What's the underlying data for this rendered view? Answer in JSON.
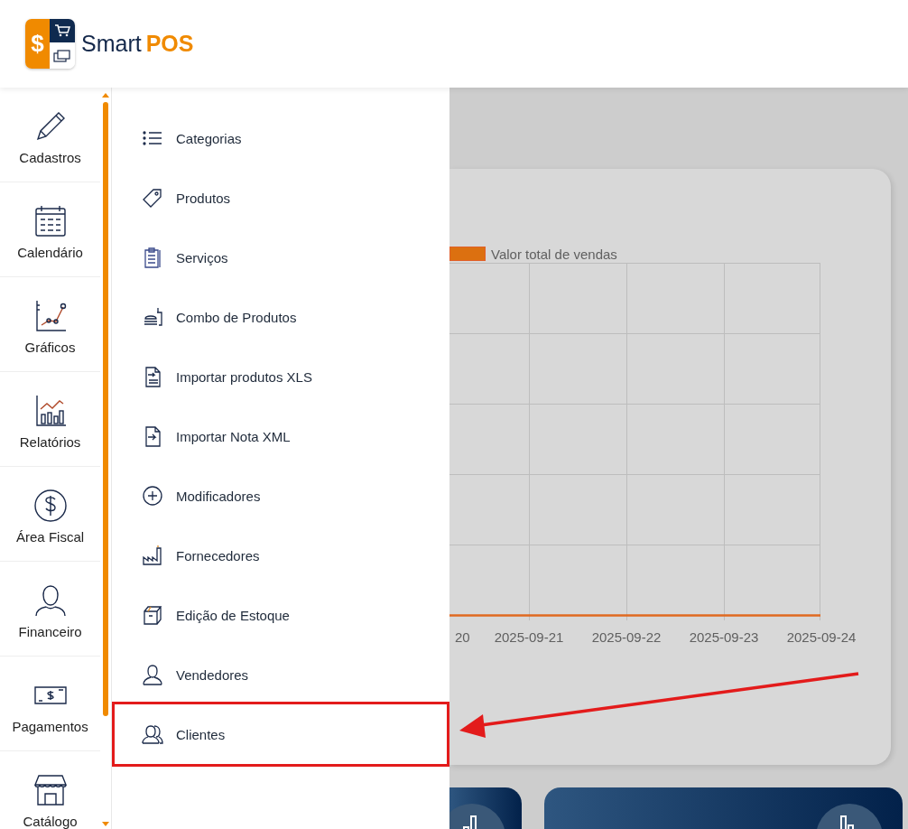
{
  "logo": {
    "symbol": "$",
    "name": "Smart",
    "accent": "POS"
  },
  "rail": [
    {
      "label": "Cadastros"
    },
    {
      "label": "Calendário"
    },
    {
      "label": "Gráficos"
    },
    {
      "label": "Relatórios"
    },
    {
      "label": "Área Fiscal"
    },
    {
      "label": "Financeiro"
    },
    {
      "label": "Pagamentos"
    },
    {
      "label": "Catálogo"
    }
  ],
  "submenu": [
    {
      "label": "Categorias",
      "highlighted": false
    },
    {
      "label": "Produtos",
      "highlighted": false
    },
    {
      "label": "Serviços",
      "highlighted": false
    },
    {
      "label": "Combo de Produtos",
      "highlighted": false
    },
    {
      "label": "Importar produtos XLS",
      "highlighted": false
    },
    {
      "label": "Importar Nota XML",
      "highlighted": false
    },
    {
      "label": "Modificadores",
      "highlighted": false
    },
    {
      "label": "Fornecedores",
      "highlighted": false
    },
    {
      "label": "Edição de Estoque",
      "highlighted": false
    },
    {
      "label": "Vendedores",
      "highlighted": false
    },
    {
      "label": "Clientes",
      "highlighted": true
    }
  ],
  "chart": {
    "legend": "Valor total de vendas",
    "x_labels": [
      "20",
      "2025-09-21",
      "2025-09-22",
      "2025-09-23",
      "2025-09-24"
    ]
  }
}
